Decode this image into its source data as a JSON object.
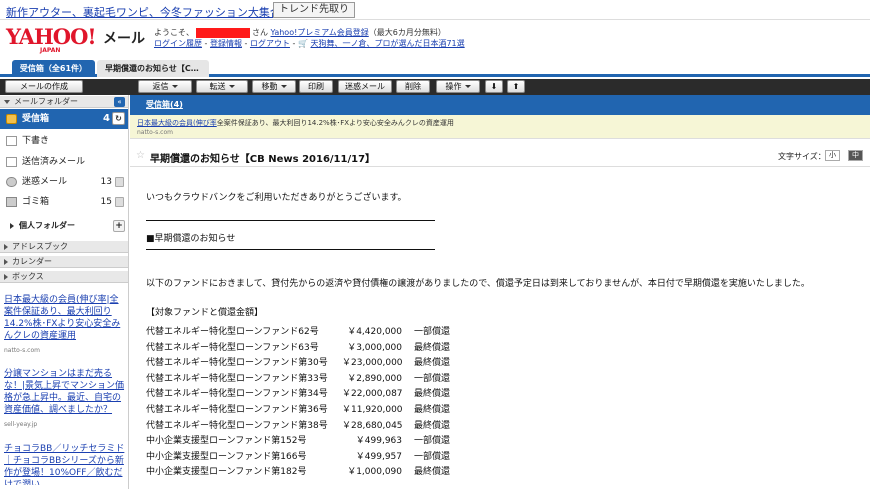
{
  "promo": {
    "link_text": "新作アウター、裏起毛ワンピ、今冬ファッション大集合！",
    "trend_button": "トレンド先取り"
  },
  "header": {
    "logo_text": "YAHOO!",
    "logo_sub": "JAPAN",
    "service_name": "メール",
    "welcome_prefix": "ようこそ、",
    "welcome_suffix": "さん",
    "premium_link": "Yahoo!プレミアム会員登録",
    "premium_note": "（最大6カ月分無料）",
    "links": [
      "ログイン履歴",
      "登録情報",
      "ログアウト",
      "天狗舞、一ノ倉、プロが選んだ日本酒71選"
    ]
  },
  "tabs": {
    "inbox_tab": "受信箱（全61件）",
    "message_tab": "早期償還のお知らせ【C…"
  },
  "toolbar": {
    "compose": "メールの作成",
    "reply": "返信",
    "forward": "転送",
    "move": "移動",
    "print": "印刷",
    "spam": "迷惑メール",
    "delete": "削除",
    "actions": "操作",
    "down": "⬇",
    "up": "⬆"
  },
  "sidebar": {
    "folders_heading": "メールフォルダー",
    "collapse": "«",
    "folders": [
      {
        "label": "受信箱",
        "count": "4"
      },
      {
        "label": "下書き",
        "count": ""
      },
      {
        "label": "送信済みメール",
        "count": ""
      },
      {
        "label": "迷惑メール",
        "count": "13"
      },
      {
        "label": "ゴミ箱",
        "count": "15"
      }
    ],
    "personal_folder": "個人フォルダー",
    "address_book": "アドレスブック",
    "calendar": "カレンダー",
    "box": "ボックス",
    "ads": [
      {
        "text": "日本最大級の会員(伸び率|全案件保証あり、最大利回り14.2%株･FXより安心安全みんクレの資産運用",
        "source": "natto-s.com"
      },
      {
        "text": "分譲マンションはまだ売るな！|景気上昇でマンション価格が急上昇中。最近、自宅の資産価値、調べましたか？",
        "source": "sell-yeay.jp"
      },
      {
        "text": "チョコラBB／リッチセラミド｜チョコラBBシリーズから新作が登場！10%OFF／飲むだけで潤い",
        "source": ""
      }
    ]
  },
  "content": {
    "folder_title": "受信箱(4)",
    "ad_banner": {
      "link": "日本最大級の会員(伸び率",
      "text": "全案件保証あり、最大利回り14.2%株･FXより安心安全みんクレの資産運用",
      "source": "natto-s.com"
    },
    "subject": "早期償還のお知らせ【CB News 2016/11/17】",
    "font_size_label": "文字サイズ：",
    "font_small": "小",
    "font_mid": "中",
    "greeting": "いつもクラウドバンクをご利用いただきありがとうございます。",
    "section_title": "■早期償還のお知らせ",
    "paragraph": "以下のファンドにおきまして、貸付先からの返済や貸付債権の譲渡がありましたので、償還予定日は到来しておりませんが、本日付で早期償還を実施いたしました。",
    "list_header": "【対象ファンドと償還金額】",
    "funds": [
      {
        "name": "代替エネルギー特化型ローンファンド62号",
        "amount": "￥4,420,000",
        "status": "一部償還"
      },
      {
        "name": "代替エネルギー特化型ローンファンド63号",
        "amount": "￥3,000,000",
        "status": "最終償還"
      },
      {
        "name": "代替エネルギー特化型ローンファンド第30号",
        "amount": "￥23,000,000",
        "status": "最終償還"
      },
      {
        "name": "代替エネルギー特化型ローンファンド第33号",
        "amount": "￥2,890,000",
        "status": "一部償還"
      },
      {
        "name": "代替エネルギー特化型ローンファンド第34号",
        "amount": "￥22,000,087",
        "status": "最終償還"
      },
      {
        "name": "代替エネルギー特化型ローンファンド第36号",
        "amount": "￥11,920,000",
        "status": "最終償還"
      },
      {
        "name": "代替エネルギー特化型ローンファンド第38号",
        "amount": "￥28,680,045",
        "status": "最終償還"
      },
      {
        "name": "中小企業支援型ローンファンド第152号",
        "amount": "￥499,963",
        "status": "一部償還"
      },
      {
        "name": "中小企業支援型ローンファンド第166号",
        "amount": "￥499,957",
        "status": "一部償還"
      },
      {
        "name": "中小企業支援型ローンファンド第182号",
        "amount": "￥1,000,090",
        "status": "最終償還"
      }
    ]
  }
}
